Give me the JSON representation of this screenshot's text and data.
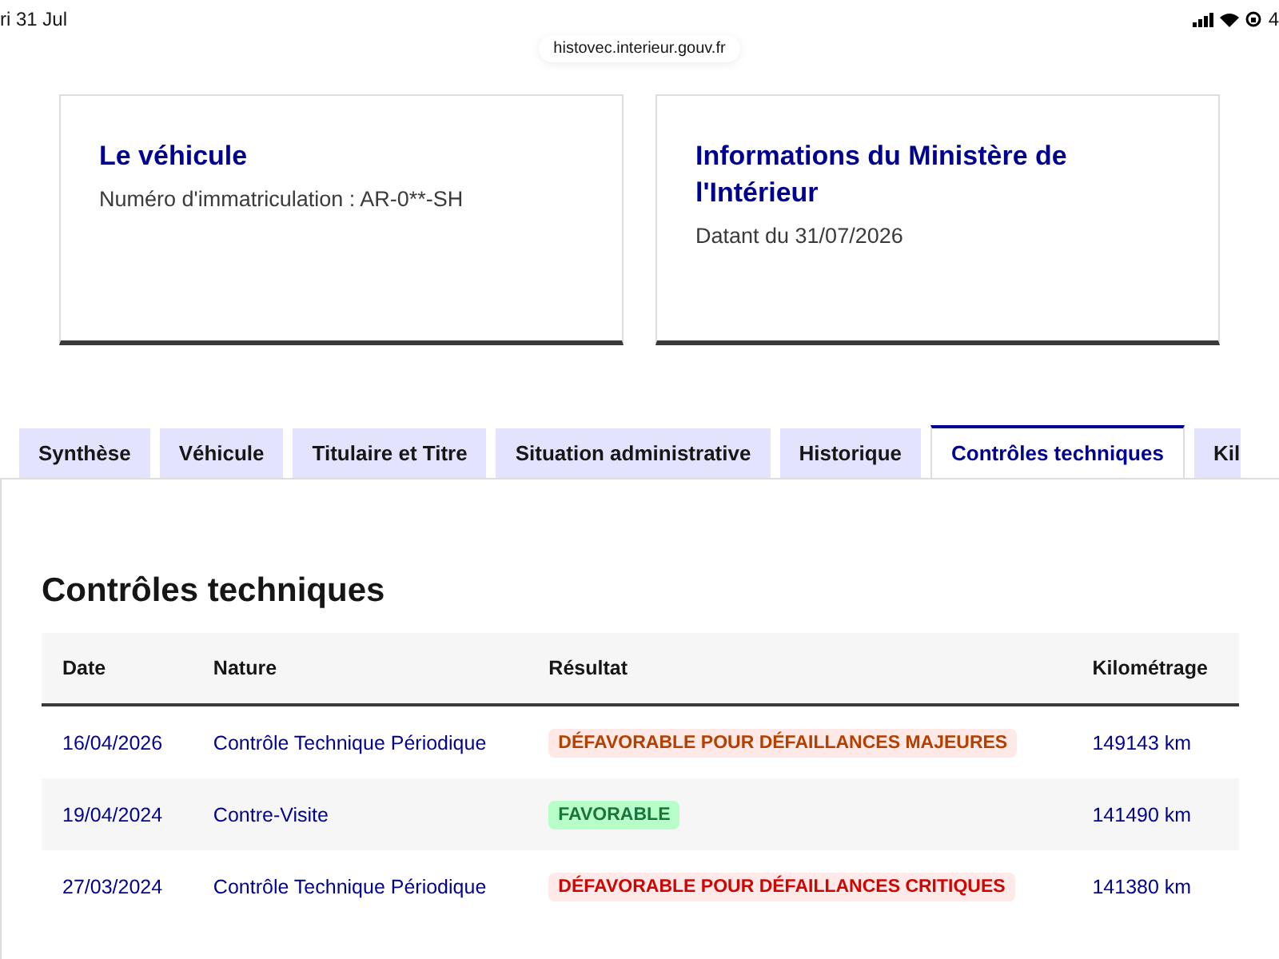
{
  "status_bar": {
    "date": "ri 31 Jul",
    "battery": "4"
  },
  "address_bar": {
    "url": "histovec.interieur.gouv.fr"
  },
  "cards": [
    {
      "title": "Le véhicule",
      "text": "Numéro d'immatriculation : AR-0**-SH"
    },
    {
      "title": "Informations du Ministère de l'Intérieur",
      "text": "Datant du 31/07/2026"
    }
  ],
  "tabs": [
    {
      "label": "Synthèse",
      "selected": false
    },
    {
      "label": "Véhicule",
      "selected": false
    },
    {
      "label": "Titulaire et Titre",
      "selected": false
    },
    {
      "label": "Situation administrative",
      "selected": false
    },
    {
      "label": "Historique",
      "selected": false
    },
    {
      "label": "Contrôles techniques",
      "selected": true
    },
    {
      "label": "Kil",
      "selected": false
    }
  ],
  "section_title": "Contrôles techniques",
  "table": {
    "columns": [
      "Date",
      "Nature",
      "Résultat",
      "Kilométrage"
    ],
    "rows": [
      {
        "date": "16/04/2026",
        "nature": "Contrôle Technique Périodique",
        "result": {
          "label": "DÉFAVORABLE POUR DÉFAILLANCES MAJEURES",
          "kind": "major"
        },
        "mileage": "149143 km"
      },
      {
        "date": "19/04/2024",
        "nature": "Contre-Visite",
        "result": {
          "label": "FAVORABLE",
          "kind": "favorable"
        },
        "mileage": "141490 km"
      },
      {
        "date": "27/03/2024",
        "nature": "Contrôle Technique Périodique",
        "result": {
          "label": "DÉFAVORABLE POUR DÉFAILLANCES CRITIQUES",
          "kind": "critical"
        },
        "mileage": "141380 km"
      }
    ]
  }
}
